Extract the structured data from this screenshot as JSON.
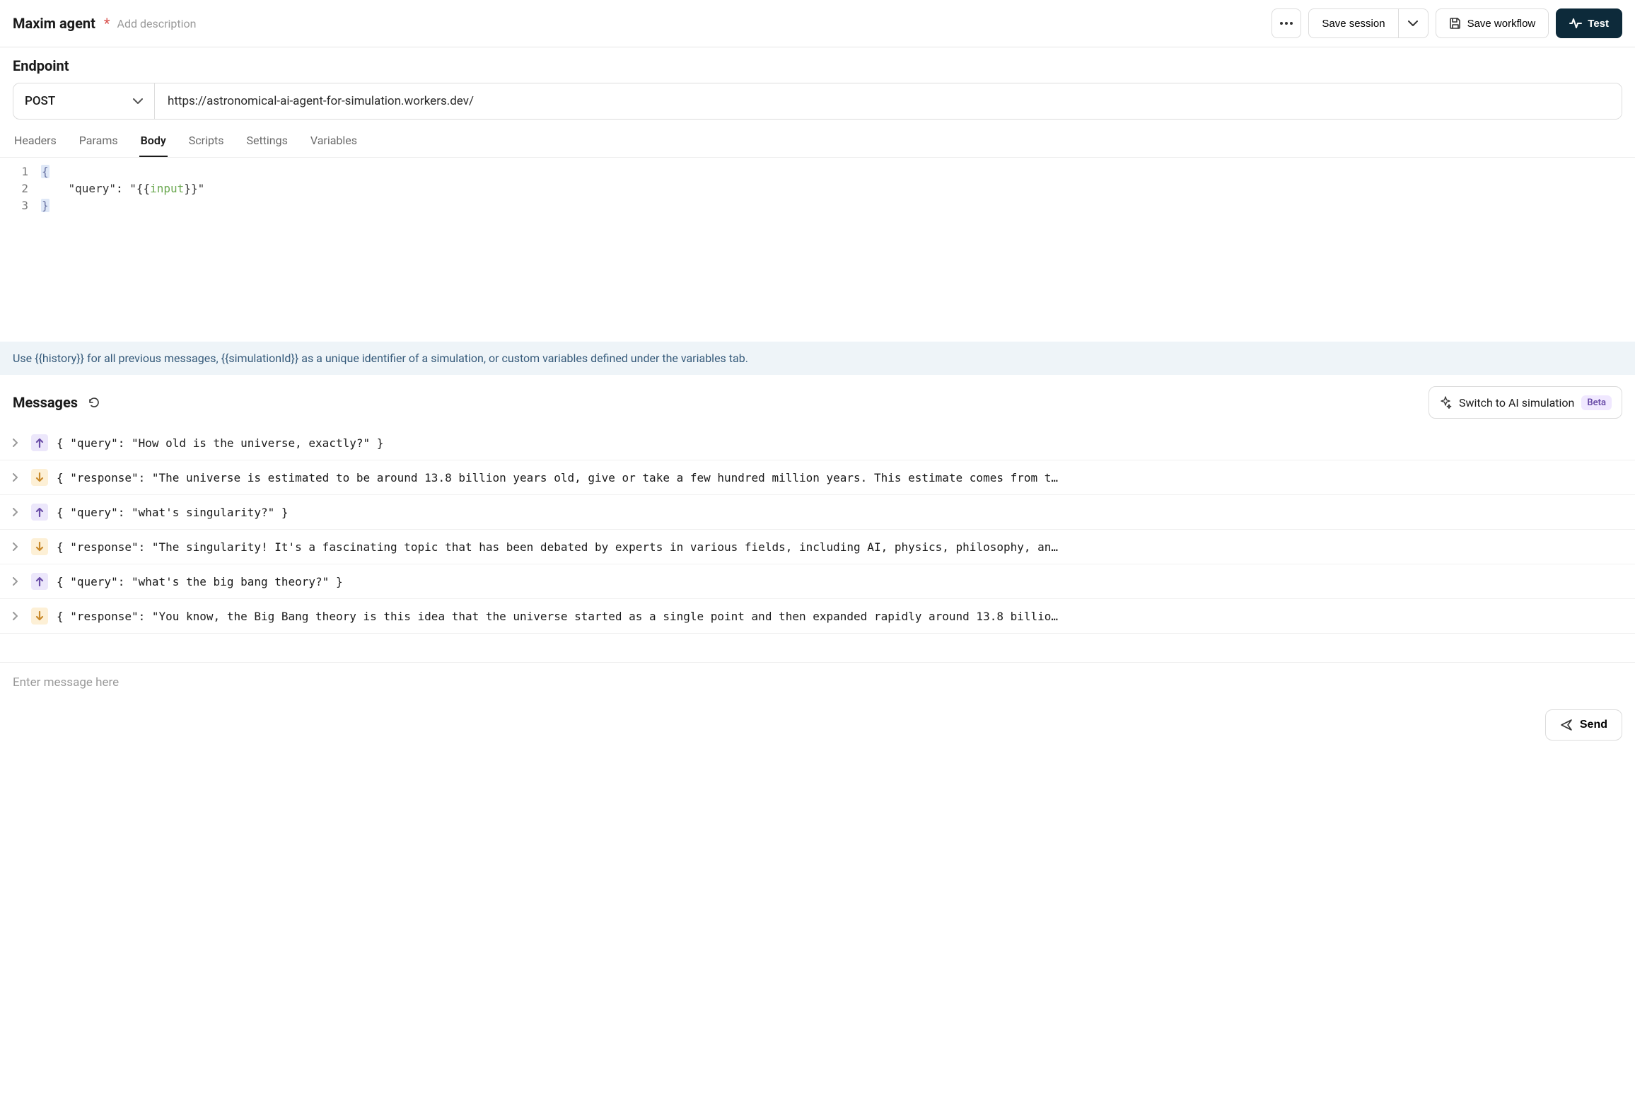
{
  "header": {
    "title": "Maxim agent",
    "unsaved_marker": "*",
    "add_description_placeholder": "Add description",
    "buttons": {
      "save_session": "Save session",
      "save_workflow": "Save workflow",
      "test": "Test"
    }
  },
  "endpoint": {
    "section_title": "Endpoint",
    "method": "POST",
    "url": "https://astronomical-ai-agent-for-simulation.workers.dev/"
  },
  "tabs": [
    "Headers",
    "Params",
    "Body",
    "Scripts",
    "Settings",
    "Variables"
  ],
  "active_tab": "Body",
  "body_editor": {
    "lines": [
      {
        "n": "1",
        "prefix": "",
        "brace": "{"
      },
      {
        "n": "2",
        "content": "    \"query\": \"{{input}}\""
      },
      {
        "n": "3",
        "prefix": "",
        "brace": "}"
      }
    ],
    "key_text": "\"query\"",
    "colon": ": ",
    "open_quote": "\"{{",
    "var_name": "input",
    "close_quote": "}}\""
  },
  "hint": "Use {{history}} for all previous messages, {{simulationId}} as a unique identifier of a simulation, or custom variables defined under the variables tab.",
  "messages": {
    "title": "Messages",
    "switch_label": "Switch to AI simulation",
    "beta_label": "Beta",
    "items": [
      {
        "dir": "up",
        "text": "{ \"query\": \"How old is the universe, exactly?\" }"
      },
      {
        "dir": "down",
        "text": "{ \"response\": \"The universe is estimated to be around 13.8 billion years old, give or take a few hundred million years. This estimate comes from t…"
      },
      {
        "dir": "up",
        "text": "{ \"query\": \"what's singularity?\" }"
      },
      {
        "dir": "down",
        "text": "{ \"response\": \"The singularity! It's a fascinating topic that has been debated by experts in various fields, including AI, physics, philosophy, an…"
      },
      {
        "dir": "up",
        "text": "{ \"query\": \"what's the big bang theory?\" }"
      },
      {
        "dir": "down",
        "text": "{ \"response\": \"You know, the Big Bang theory is this idea that the universe started as a single point and then expanded rapidly around 13.8 billio…"
      }
    ]
  },
  "input": {
    "placeholder": "Enter message here",
    "send_label": "Send"
  }
}
